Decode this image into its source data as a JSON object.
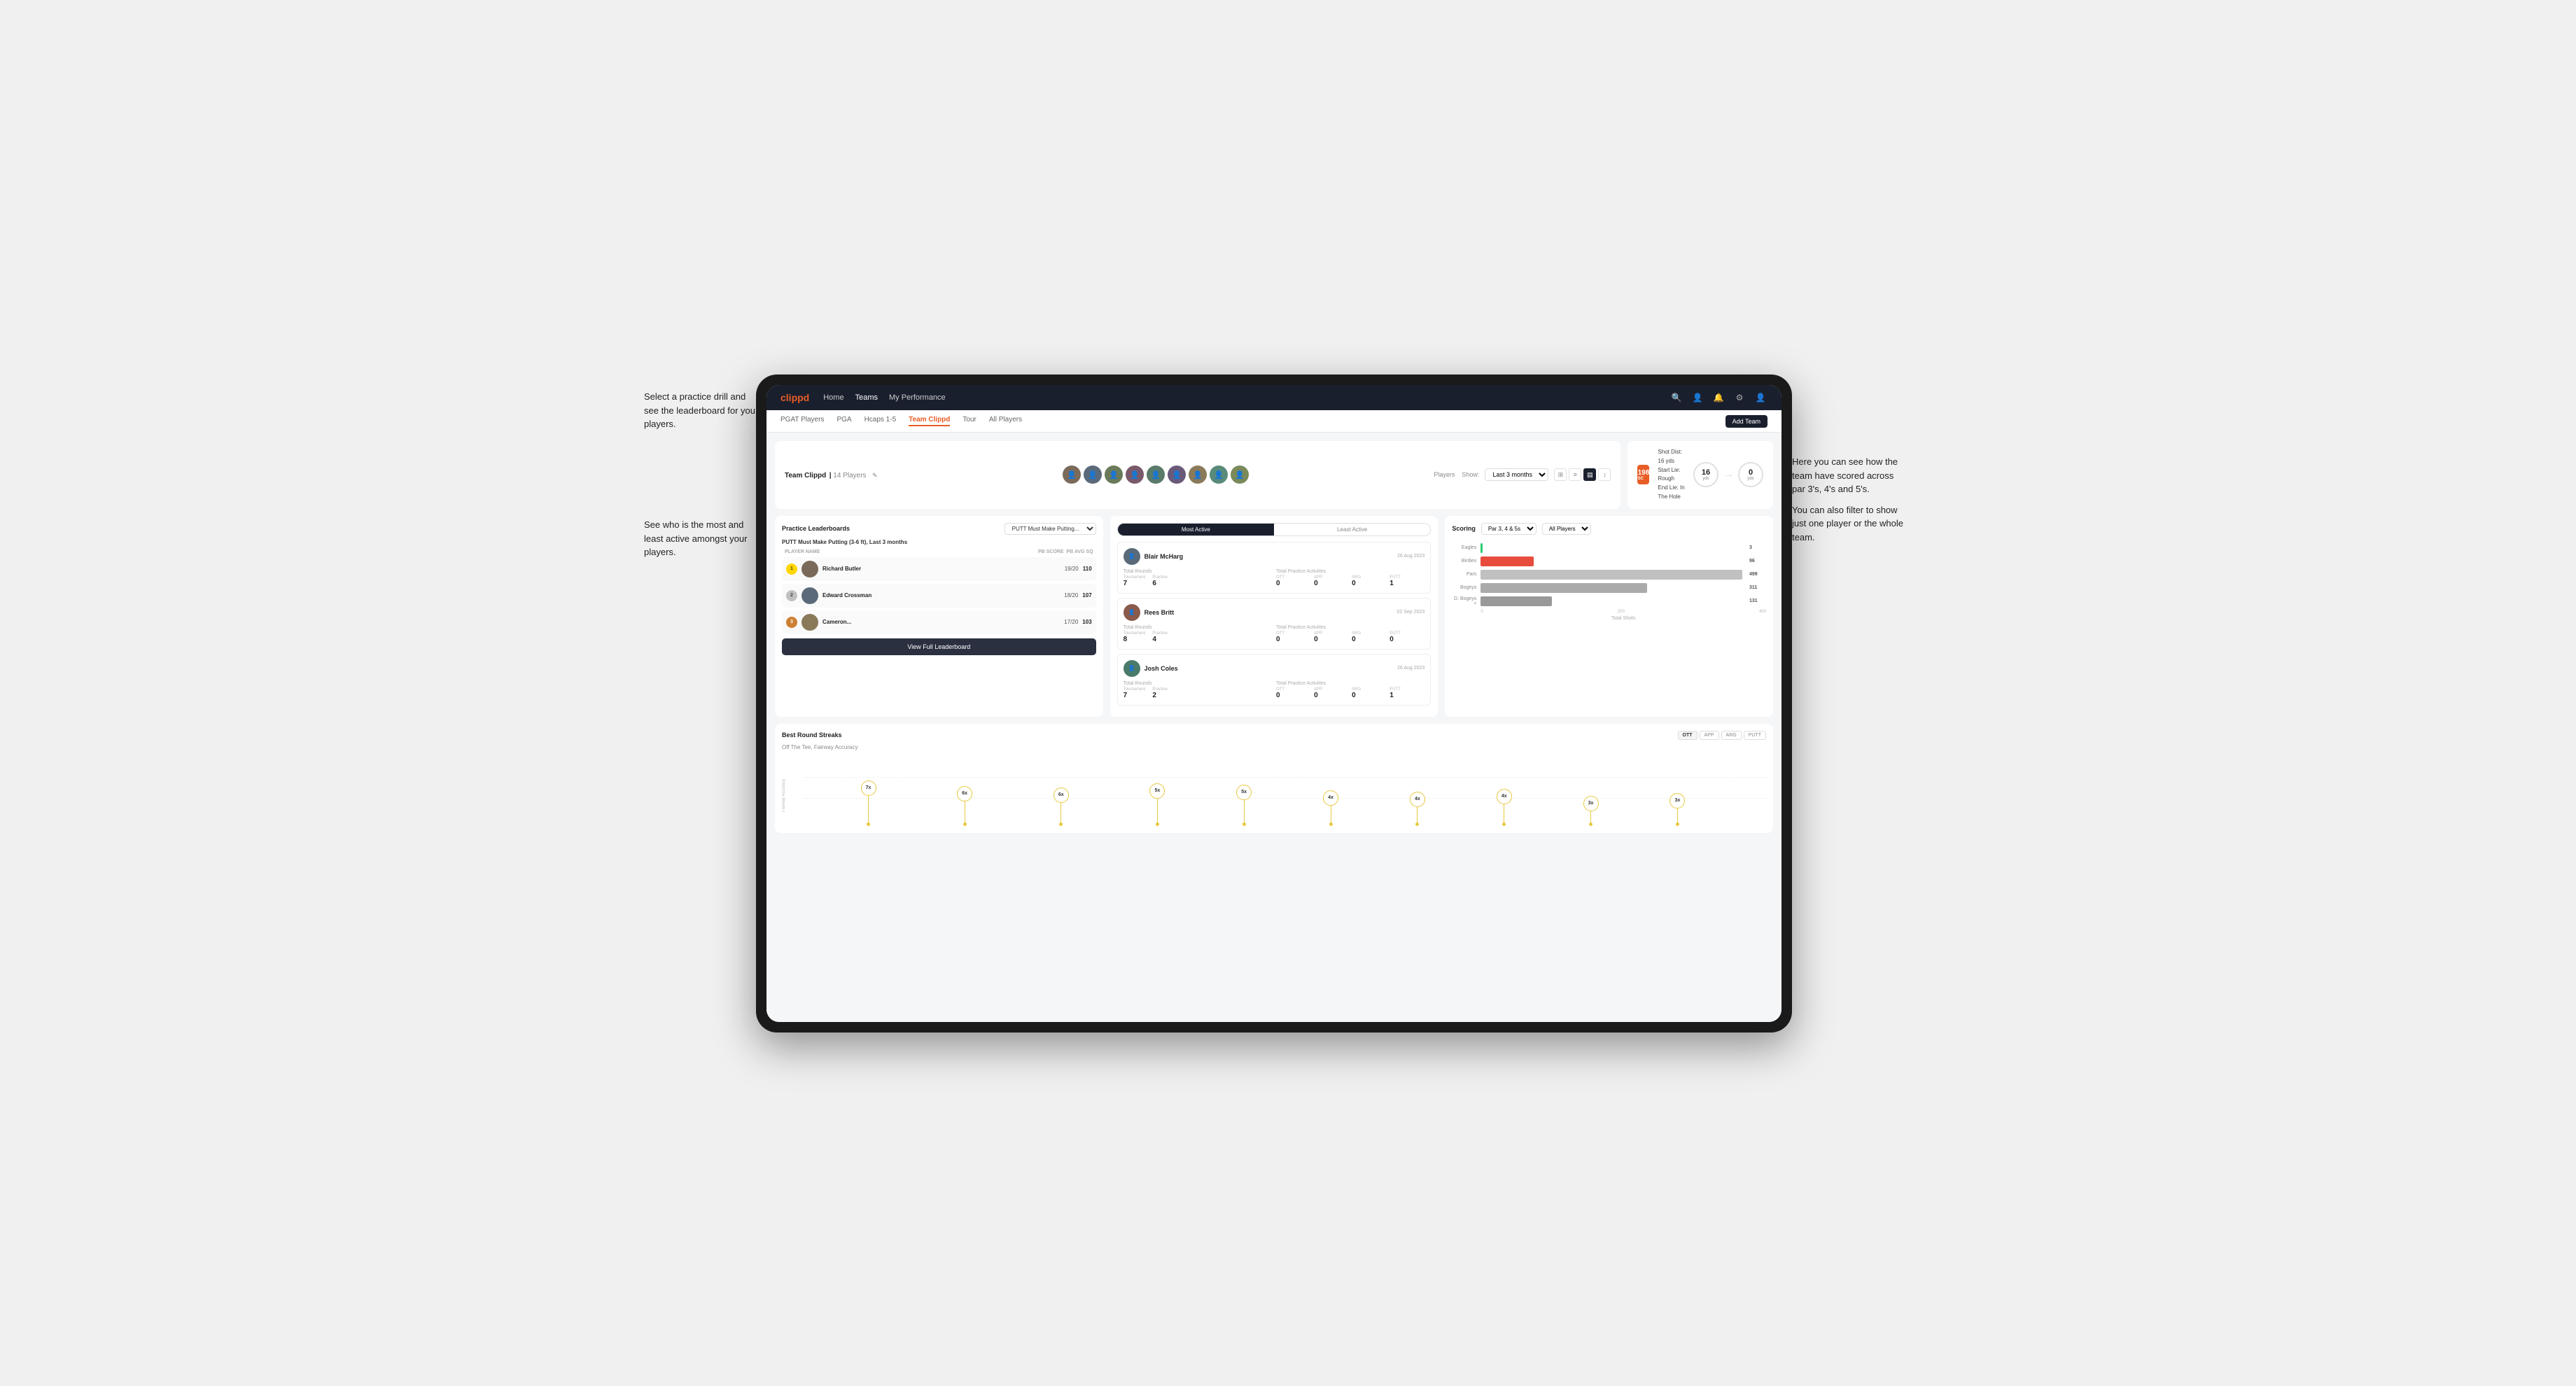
{
  "annotations": {
    "top_left": "Select a practice drill and see the leaderboard for you players.",
    "bottom_left": "See who is the most and least active amongst your players.",
    "top_right_line1": "Here you can see how the",
    "top_right_line2": "team have scored across",
    "top_right_line3": "par 3's, 4's and 5's.",
    "top_right_line4": "",
    "top_right_line5": "You can also filter to show",
    "top_right_line6": "just one player or the whole",
    "top_right_line7": "team."
  },
  "nav": {
    "logo": "clippd",
    "items": [
      "Home",
      "Teams",
      "My Performance"
    ],
    "active": "Teams"
  },
  "subnav": {
    "items": [
      "PGAT Players",
      "PGA",
      "Hcaps 1-5",
      "Team Clippd",
      "Tour",
      "All Players"
    ],
    "active": "Team Clippd",
    "add_team": "Add Team"
  },
  "team_header": {
    "title": "Team Clippd",
    "player_count": "14 Players",
    "show_label": "Show:",
    "show_value": "Last 3 months",
    "players_label": "Players"
  },
  "shot_info": {
    "badge": "198",
    "badge_sub": "SC",
    "line1": "Shot Dist: 16 yds",
    "line2": "Start Lie: Rough",
    "line3": "End Lie: In The Hole",
    "circle1_val": "16",
    "circle1_unit": "yds",
    "circle2_val": "0",
    "circle2_unit": "yds"
  },
  "practice_lb": {
    "section_title": "Practice Leaderboards",
    "drill_select": "PUTT Must Make Putting...",
    "subtitle_drill": "PUTT Must Make Putting (3-6 ft),",
    "subtitle_period": "Last 3 months",
    "col_player": "PLAYER NAME",
    "col_pb": "PB SCORE",
    "col_sq": "PB AVG SQ",
    "players": [
      {
        "rank": 1,
        "name": "Richard Butler",
        "score": "19/20",
        "sq": "110",
        "avatar": "av1"
      },
      {
        "rank": 2,
        "name": "Edward Crossman",
        "score": "18/20",
        "sq": "107",
        "avatar": "av2"
      },
      {
        "rank": 3,
        "name": "Cameron...",
        "score": "17/20",
        "sq": "103",
        "avatar": "av3"
      }
    ],
    "view_btn": "View Full Leaderboard"
  },
  "activity": {
    "tab_active": "Most Active",
    "tab_inactive": "Least Active",
    "players": [
      {
        "name": "Blair McHarg",
        "date": "26 Aug 2023",
        "total_rounds_label": "Total Rounds",
        "tournament_label": "Tournament",
        "tournament_val": "7",
        "practice_label": "Practice",
        "practice_val": "6",
        "total_practice_label": "Total Practice Activities",
        "ott": "0",
        "app": "0",
        "arg": "0",
        "putt": "1"
      },
      {
        "name": "Rees Britt",
        "date": "02 Sep 2023",
        "total_rounds_label": "Total Rounds",
        "tournament_label": "Tournament",
        "tournament_val": "8",
        "practice_label": "Practice",
        "practice_val": "4",
        "total_practice_label": "Total Practice Activities",
        "ott": "0",
        "app": "0",
        "arg": "0",
        "putt": "0"
      },
      {
        "name": "Josh Coles",
        "date": "26 Aug 2023",
        "total_rounds_label": "Total Rounds",
        "tournament_label": "Tournament",
        "tournament_val": "7",
        "practice_label": "Practice",
        "practice_val": "2",
        "total_practice_label": "Total Practice Activities",
        "ott": "0",
        "app": "0",
        "arg": "0",
        "putt": "1"
      }
    ]
  },
  "scoring": {
    "title": "Scoring",
    "filter1": "Par 3, 4 & 5s",
    "filter2": "All Players",
    "bars": [
      {
        "label": "Eagles",
        "value": 3,
        "max": 500,
        "color": "eagles"
      },
      {
        "label": "Birdies",
        "value": 96,
        "max": 500,
        "color": "birdies"
      },
      {
        "label": "Pars",
        "value": 499,
        "max": 500,
        "color": "pars"
      },
      {
        "label": "Bogeys",
        "value": 311,
        "max": 500,
        "color": "bogeys"
      },
      {
        "label": "D. Bogeys +",
        "value": 131,
        "max": 500,
        "color": "dbogeys"
      }
    ],
    "x_ticks": [
      "0",
      "200",
      "400"
    ],
    "x_label": "Total Shots"
  },
  "streaks": {
    "title": "Best Round Streaks",
    "subtitle": "Off The Tee, Fairway Accuracy",
    "filters": [
      "OTT",
      "APP",
      "ARG",
      "PUTT"
    ],
    "active_filter": "OTT",
    "y_label": "Fairway Accuracy",
    "bubbles": [
      {
        "label": "7x",
        "left": 7,
        "height": 60
      },
      {
        "label": "6x",
        "left": 19,
        "height": 48
      },
      {
        "label": "6x",
        "left": 28,
        "height": 44
      },
      {
        "label": "5x",
        "left": 38,
        "height": 55
      },
      {
        "label": "5x",
        "left": 47,
        "height": 50
      },
      {
        "label": "4x",
        "left": 57,
        "height": 38
      },
      {
        "label": "4x",
        "left": 65,
        "height": 34
      },
      {
        "label": "4x",
        "left": 73,
        "height": 42
      },
      {
        "label": "3x",
        "left": 82,
        "height": 28
      },
      {
        "label": "3x",
        "left": 90,
        "height": 32
      }
    ]
  }
}
